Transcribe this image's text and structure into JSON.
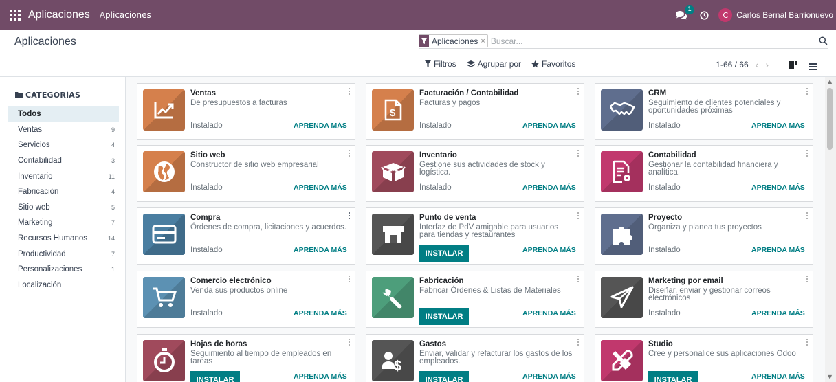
{
  "navbar": {
    "app_name": "Aplicaciones",
    "menu_item": "Aplicaciones",
    "chat_count": "1",
    "user_initial": "C",
    "user_name": "Carlos Bernal Barrionuevo"
  },
  "control": {
    "breadcrumb": "Aplicaciones",
    "facet_label": "Aplicaciones",
    "facet_remove": "×",
    "search_placeholder": "Buscar...",
    "filters_label": "Filtros",
    "groupby_label": "Agrupar por",
    "favorites_label": "Favoritos",
    "pager": "1-66 / 66"
  },
  "sidebar": {
    "title": "CATEGORÍAS",
    "items": [
      {
        "label": "Todos",
        "count": "",
        "active": true
      },
      {
        "label": "Ventas",
        "count": "9"
      },
      {
        "label": "Servicios",
        "count": "4"
      },
      {
        "label": "Contabilidad",
        "count": "3"
      },
      {
        "label": "Inventario",
        "count": "11"
      },
      {
        "label": "Fabricación",
        "count": "4"
      },
      {
        "label": "Sitio web",
        "count": "5"
      },
      {
        "label": "Marketing",
        "count": "7"
      },
      {
        "label": "Recursos Humanos",
        "count": "14"
      },
      {
        "label": "Productividad",
        "count": "7"
      },
      {
        "label": "Personalizaciones",
        "count": "1"
      },
      {
        "label": "Localización",
        "count": ""
      }
    ]
  },
  "labels": {
    "installed": "Instalado",
    "learn_more": "APRENDA MÁS",
    "install": "INSTALAR"
  },
  "apps": [
    {
      "name": "Ventas",
      "desc": "De presupuestos a facturas",
      "installed": true,
      "icon": "trend-chart-icon",
      "color": "#d5804c"
    },
    {
      "name": "Facturación / Contabilidad",
      "desc": "Facturas y pagos",
      "installed": true,
      "icon": "invoice-dollar-icon",
      "color": "#d5804c"
    },
    {
      "name": "CRM",
      "desc": "Seguimiento de clientes potenciales y oportunidades próximas",
      "installed": true,
      "icon": "handshake-icon",
      "color": "#5f6e8e"
    },
    {
      "name": "Sitio web",
      "desc": "Constructor de sitio web empresarial",
      "installed": true,
      "icon": "globe-icon",
      "color": "#d5804c"
    },
    {
      "name": "Inventario",
      "desc": "Gestione sus actividades de stock y logística.",
      "installed": true,
      "icon": "box-icon",
      "color": "#a04a5c"
    },
    {
      "name": "Contabilidad",
      "desc": "Gestionar la contabilidad financiera y analítica.",
      "installed": true,
      "icon": "document-gear-icon",
      "color": "#c1386d"
    },
    {
      "name": "Compra",
      "desc": "Órdenes de compra, licitaciones y acuerdos.",
      "installed": true,
      "icon": "credit-card-icon",
      "color": "#4a7ea1"
    },
    {
      "name": "Punto de venta",
      "desc": "Interfaz de PdV amigable para usuarios para tiendas y restaurantes",
      "installed": false,
      "icon": "shop-icon",
      "color": "#555555"
    },
    {
      "name": "Proyecto",
      "desc": "Organiza y planea tus proyectos",
      "installed": true,
      "icon": "puzzle-icon",
      "color": "#5f6e8e"
    },
    {
      "name": "Comercio electrónico",
      "desc": "Venda sus productos online",
      "installed": true,
      "icon": "cart-icon",
      "color": "#5c91b3"
    },
    {
      "name": "Fabricación",
      "desc": "Fabricar Órdenes & Listas de Materiales",
      "installed": false,
      "icon": "wrench-icon",
      "color": "#4d9e7b"
    },
    {
      "name": "Marketing por email",
      "desc": "Diseñar, enviar y gestionar correos electrónicos",
      "installed": true,
      "icon": "paper-plane-icon",
      "color": "#555555"
    },
    {
      "name": "Hojas de horas",
      "desc": "Seguimiento al tiempo de empleados en tareas",
      "installed": false,
      "icon": "stopwatch-icon",
      "color": "#a04a5c"
    },
    {
      "name": "Gastos",
      "desc": "Enviar, validar y refacturar los gastos de los empleados.",
      "installed": false,
      "icon": "user-dollar-icon",
      "color": "#555555"
    },
    {
      "name": "Studio",
      "desc": "Cree y personalice sus aplicaciones Odoo",
      "installed": false,
      "icon": "tools-icon",
      "color": "#c1386d"
    }
  ],
  "colors": {
    "navbar": "#714b67",
    "accent": "#017e84",
    "active_category": "#e4eef3"
  }
}
